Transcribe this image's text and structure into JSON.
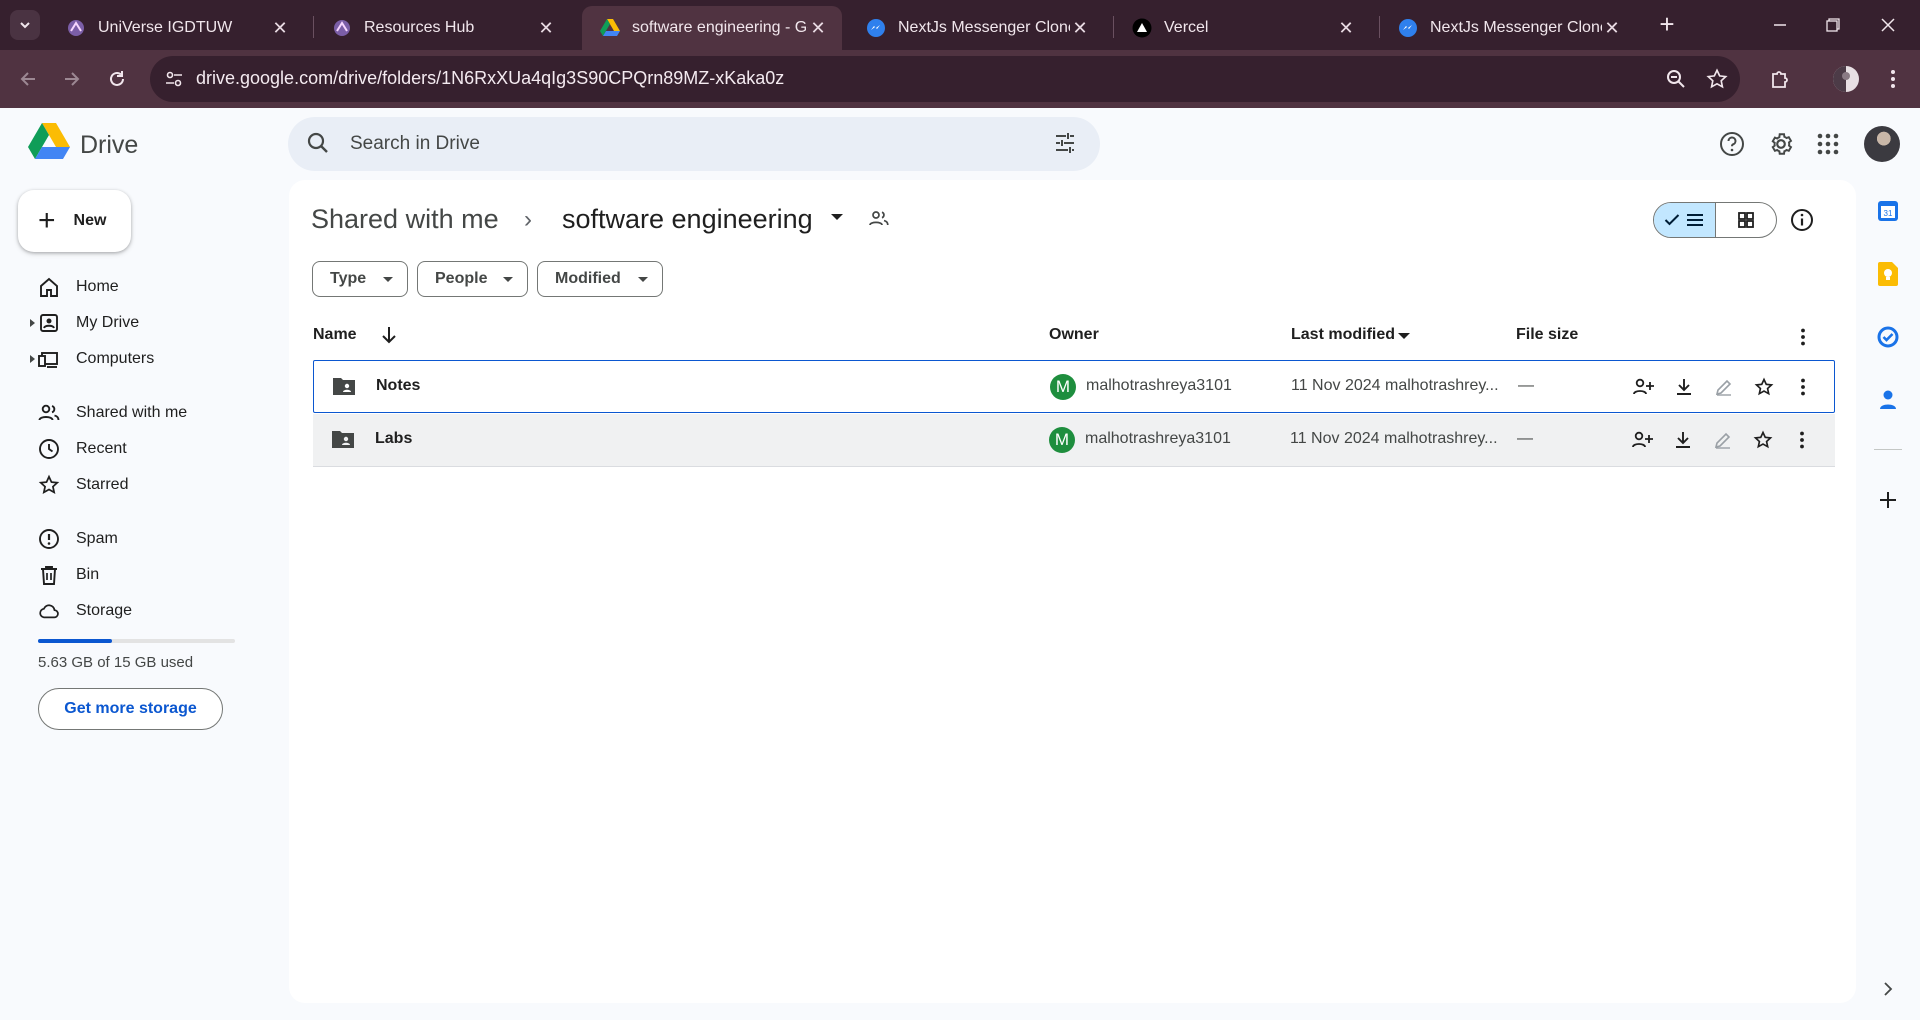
{
  "browser": {
    "tabs": [
      {
        "title": "UniVerse IGDTUW",
        "active": false
      },
      {
        "title": "Resources Hub",
        "active": false
      },
      {
        "title": "software engineering - Goo",
        "active": true
      },
      {
        "title": "NextJs Messenger Clone",
        "active": false
      },
      {
        "title": "Vercel",
        "active": false
      },
      {
        "title": "NextJs Messenger Clone",
        "active": false
      }
    ],
    "url": "drive.google.com/drive/folders/1N6RxXUa4qIg3S90CPQrn89MZ-xKaka0z"
  },
  "app": {
    "name": "Drive",
    "search_placeholder": "Search in Drive"
  },
  "sidebar": {
    "new_label": "New",
    "items": [
      {
        "label": "Home",
        "icon": "home-icon"
      },
      {
        "label": "My Drive",
        "icon": "my-drive-icon"
      },
      {
        "label": "Computers",
        "icon": "computers-icon"
      },
      {
        "label": "Shared with me",
        "icon": "shared-icon"
      },
      {
        "label": "Recent",
        "icon": "clock-icon"
      },
      {
        "label": "Starred",
        "icon": "star-icon"
      },
      {
        "label": "Spam",
        "icon": "spam-icon"
      },
      {
        "label": "Bin",
        "icon": "bin-icon"
      },
      {
        "label": "Storage",
        "icon": "cloud-icon"
      }
    ],
    "storage_used_fraction": 0.375,
    "storage_text": "5.63 GB of 15 GB used",
    "get_storage_label": "Get more storage"
  },
  "breadcrumb": {
    "root": "Shared with me",
    "current": "software engineering"
  },
  "filters": [
    "Type",
    "People",
    "Modified"
  ],
  "columns": {
    "name": "Name",
    "owner": "Owner",
    "modified": "Last modified",
    "size": "File size"
  },
  "files": [
    {
      "name": "Notes",
      "owner_initial": "M",
      "owner": "malhotrashreya3101",
      "modified": "11 Nov 2024 malhotrashrey...",
      "size": "—"
    },
    {
      "name": "Labs",
      "owner_initial": "M",
      "owner": "malhotrashreya3101",
      "modified": "11 Nov 2024 malhotrashrey...",
      "size": "—"
    }
  ],
  "colors": {
    "accent": "#0b57d0",
    "chrome_dark": "#36202e",
    "chrome_toolbar": "#503341",
    "owner_avatar": "#1e8e3e"
  }
}
